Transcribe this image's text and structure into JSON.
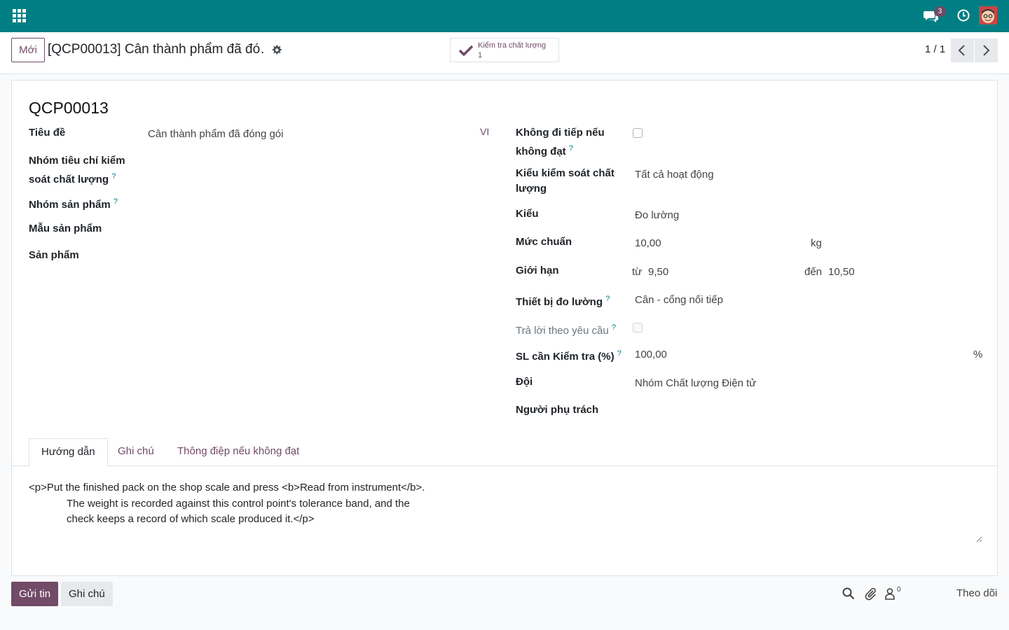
{
  "navbar": {
    "apps_icon": "apps-grid-icon",
    "messages_icon": "chat-icon",
    "messages_count": "3",
    "activity_icon": "clock-icon",
    "avatar_icon": "user-avatar",
    "accent_color": "#017e84"
  },
  "control_panel": {
    "new_button": "Mới",
    "breadcrumb_title": "[QCP00013] Cân thành phẩm đã đó…",
    "settings_icon": "gear-icon",
    "smart_button": {
      "label": "Kiểm tra chất lượng",
      "count": "1",
      "icon": "check-icon"
    },
    "pager": "1 / 1",
    "prev_icon": "chevron-left-icon",
    "next_icon": "chevron-right-icon"
  },
  "form": {
    "record_name": "QCP00013",
    "left": {
      "title_label": "Tiêu đề",
      "title_value": "Cân thành phẩm đã đóng gói",
      "lang": "VI",
      "qc_group_label_1": "Nhóm tiêu chí kiểm",
      "qc_group_label_2": "soát chất lượng",
      "product_category_label": "Nhóm sản phẩm",
      "product_template_label": "Mẫu sản phẩm",
      "product_label": "Sản phẩm"
    },
    "right": {
      "no_continue_label_1": "Không đi tiếp nếu",
      "no_continue_label_2": "không đạt",
      "no_continue_checked": false,
      "op_type_label_1": "Kiểu kiểm soát chất",
      "op_type_label_2": "lượng",
      "op_type_value": "Tất cả hoạt động",
      "type_label": "Kiểu",
      "type_value": "Đo lường",
      "norm_label": "Mức chuẩn",
      "norm_value": "10,00",
      "norm_unit": "kg",
      "tolerance_label": "Giới hạn",
      "tol_from_label": "từ",
      "tol_from_value": "9,50",
      "tol_to_label": "đến",
      "tol_to_value": "10,50",
      "device_label": "Thiết bị đo lường",
      "device_value": "Cân - cổng nối tiếp",
      "on_demand_label": "Trả lời theo yêu cầu",
      "on_demand_checked": false,
      "qty_label": "SL cần Kiểm tra (%)",
      "qty_value": "100,00",
      "qty_unit": "%",
      "team_label": "Đội",
      "team_value": "Nhóm Chất lượng Điện tử",
      "responsible_label": "Người phụ trách",
      "help_mark": "?"
    },
    "tabs": [
      {
        "label": "Hướng dẫn",
        "active": true
      },
      {
        "label": "Ghi chú",
        "active": false
      },
      {
        "label": "Thông điệp nếu không đạt",
        "active": false
      }
    ],
    "note_line_1": "<p>Put the finished pack on the shop scale and press <b>Read from instrument</b>.",
    "note_line_2": "The weight is recorded against this control point's tolerance band, and the",
    "note_line_3": "check keeps a record of which scale produced it.</p>"
  },
  "chatter": {
    "send_message": "Gửi tin",
    "log_note": "Ghi chú",
    "search_icon": "search-icon",
    "attachment_icon": "paperclip-icon",
    "followers_icon": "user-icon",
    "followers_count": "0",
    "follow": "Theo dõi",
    "brand_color": "#714b67"
  }
}
